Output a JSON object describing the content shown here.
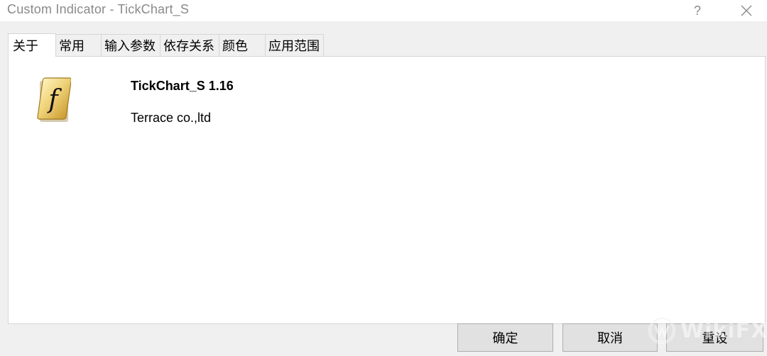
{
  "window": {
    "title": "Custom Indicator - TickChart_S",
    "help_label": "?"
  },
  "tabs": [
    {
      "label": "关于",
      "active": true
    },
    {
      "label": "常用",
      "active": false
    },
    {
      "label": "输入参数",
      "active": false
    },
    {
      "label": "依存关系",
      "active": false
    },
    {
      "label": "颜色",
      "active": false
    },
    {
      "label": "应用范围",
      "active": false
    }
  ],
  "about": {
    "icon": "function-f-icon",
    "name": "TickChart_S 1.16",
    "company": "Terrace co.,ltd"
  },
  "buttons": {
    "ok": "确定",
    "cancel": "取消",
    "reset": "重设"
  },
  "watermark": {
    "text": "WikiFX"
  },
  "colors": {
    "titlebar": "#ffffff",
    "dialog_bg": "#f0f0f0",
    "panel_bg": "#ffffff",
    "border": "#d6d6d6",
    "button_bg": "#e1e1e1",
    "button_border": "#adadad",
    "icon_gold": "#e8c85a"
  }
}
